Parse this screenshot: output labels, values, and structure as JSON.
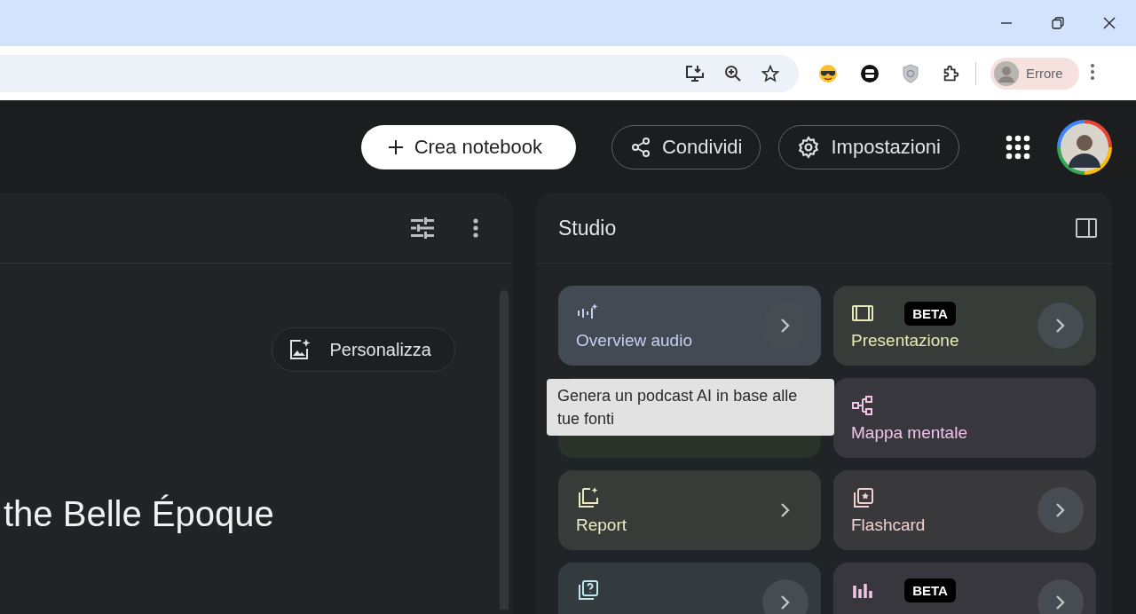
{
  "browser": {
    "profile_name": "Errore"
  },
  "header": {
    "buttons": [
      {
        "label": "Crea notebook",
        "kind": "primary"
      },
      {
        "label": "Condividi",
        "kind": "outline"
      },
      {
        "label": "Impostazioni",
        "kind": "outline"
      }
    ]
  },
  "sources_panel": {
    "customize_button": "Personalizza",
    "notebook_title": "the Belle Époque"
  },
  "studio": {
    "title": "Studio",
    "cards": [
      {
        "label": "Overview audio",
        "color": "#c4cff0",
        "hovered": true,
        "chevron": true,
        "chevron_circle": true
      },
      {
        "label": "Presentazione",
        "badge": "BETA",
        "color": "#e6eab8",
        "hovered": false,
        "chevron": true,
        "chevron_circle": true
      },
      {
        "hovered": false,
        "chevron": false
      },
      {
        "label": "Mappa mentale",
        "color": "#efc4e6",
        "hovered": false,
        "chevron": false
      },
      {
        "label": "Report",
        "color": "#e9ecc0",
        "hovered": false,
        "chevron": true,
        "chevron_circle": false
      },
      {
        "label": "Flashcard",
        "color": "#f2d2cc",
        "hovered": false,
        "chevron": true,
        "chevron_circle": true
      },
      {
        "color": "#bfe6ee",
        "hovered": false,
        "chevron": true,
        "chevron_circle": true
      },
      {
        "badge": "BETA",
        "color": "#efc4e6",
        "hovered": false,
        "chevron": true,
        "chevron_circle": true
      }
    ]
  },
  "tooltip": {
    "text": "Genera un podcast AI in base alle tue fonti"
  }
}
